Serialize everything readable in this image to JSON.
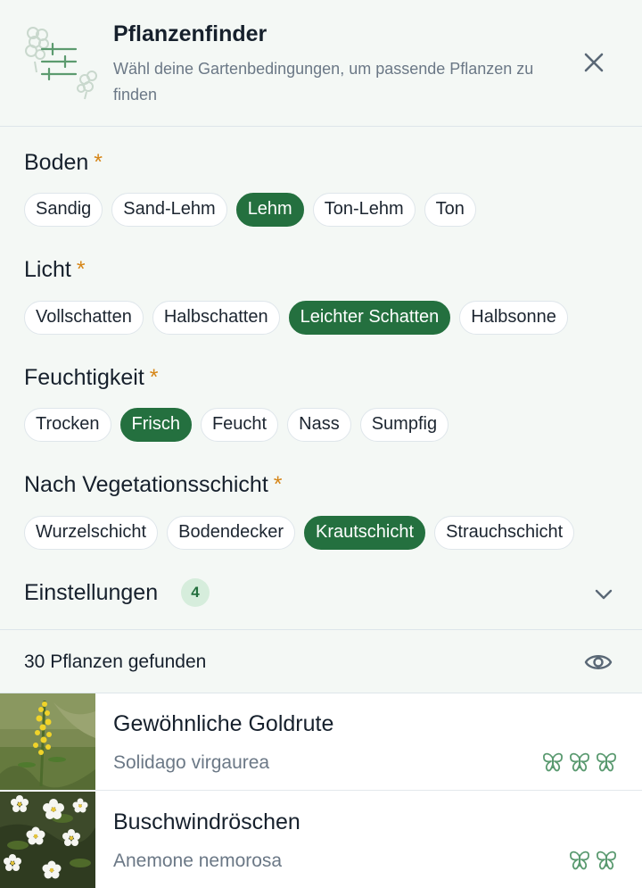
{
  "header": {
    "title": "Pflanzenfinder",
    "subtitle": "Wähl deine Gartenbedingungen, um passende Pflanzen zu finden",
    "close_icon": "close-icon"
  },
  "filters": {
    "soil": {
      "title": "Boden",
      "required_mark": "*",
      "options": [
        "Sandig",
        "Sand-Lehm",
        "Lehm",
        "Ton-Lehm",
        "Ton"
      ],
      "selected": "Lehm"
    },
    "light": {
      "title": "Licht",
      "required_mark": "*",
      "options": [
        "Vollschatten",
        "Halbschatten",
        "Leichter Schatten",
        "Halbsonne"
      ],
      "selected": "Leichter Schatten"
    },
    "moisture": {
      "title": "Feuchtigkeit",
      "required_mark": "*",
      "options": [
        "Trocken",
        "Frisch",
        "Feucht",
        "Nass",
        "Sumpfig"
      ],
      "selected": "Frisch"
    },
    "layer": {
      "title": "Nach Vegetationsschicht",
      "required_mark": "*",
      "options": [
        "Wurzelschicht",
        "Bodendecker",
        "Krautschicht",
        "Strauchschicht"
      ],
      "selected": "Krautschicht"
    },
    "settings": {
      "label": "Einstellungen",
      "badge": "4"
    }
  },
  "results": {
    "count_label": "30 Pflanzen gefunden",
    "toggle_icon": "eye-icon"
  },
  "plants": [
    {
      "name": "Gewöhnliche Goldrute",
      "latin": "Solidago virgaurea",
      "butterflies": 3
    },
    {
      "name": "Buschwindröschen",
      "latin": "Anemone nemorosa",
      "butterflies": 2
    }
  ],
  "colors": {
    "accent": "#24703f",
    "required": "#d68618",
    "panel_bg": "#f4f8f5",
    "butterfly": "#5a9a70"
  }
}
